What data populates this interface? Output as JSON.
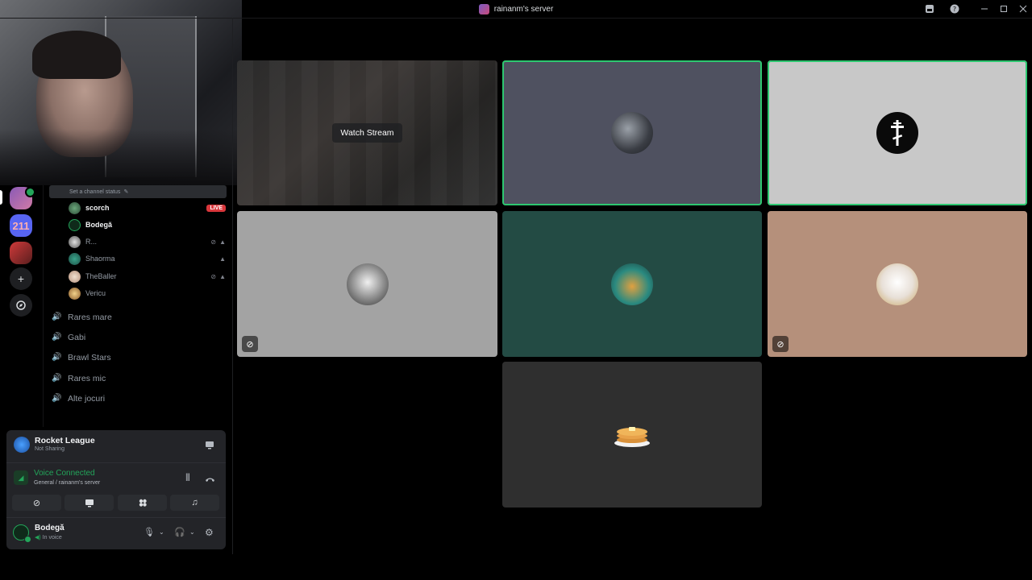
{
  "window": {
    "server_name": "rainanm's server",
    "controls": [
      "inbox-icon",
      "help-icon",
      "minimize-icon",
      "maximize-icon",
      "close-icon"
    ]
  },
  "rail": {
    "badge": "211",
    "add_icon": "+",
    "explore_icon": "compass-icon"
  },
  "channels": {
    "status_placeholder": "Set a channel status",
    "live_label": "LIVE",
    "voice_users": [
      {
        "name": "scorch",
        "bold": true,
        "live": true
      },
      {
        "name": "Bodegă",
        "bold": true
      },
      {
        "name": "R...",
        "icons": [
          "deafened-icon",
          "playstation-icon"
        ]
      },
      {
        "name": "Shaorma",
        "icons": [
          "playstation-icon"
        ]
      },
      {
        "name": "TheBaller",
        "icons": [
          "deafened-icon",
          "playstation-icon"
        ]
      },
      {
        "name": "Vericu"
      }
    ],
    "voice_channels": [
      "Rares mare",
      "Gabi",
      "Brawl Stars",
      "Rares mic",
      "Alte jocuri"
    ]
  },
  "activity": {
    "game": "Rocket League",
    "sharing": "Not Sharing"
  },
  "voice": {
    "status": "Voice Connected",
    "location": "General / rainanm's server",
    "buttons": [
      "camera-off-icon",
      "screenshare-icon",
      "activities-icon",
      "soundboard-icon"
    ]
  },
  "user": {
    "name": "Bodegă",
    "status": "In voice"
  },
  "stage": {
    "watch_stream": "Watch Stream",
    "colors": {
      "speaking": "#2dc770",
      "tile_slate": "#4f5160",
      "tile_light": "#c8c8c8",
      "tile_gray": "#a3a3a3",
      "tile_teal": "#234b44",
      "tile_tan": "#b5907b",
      "tile_dark": "#2f2f2f"
    }
  }
}
